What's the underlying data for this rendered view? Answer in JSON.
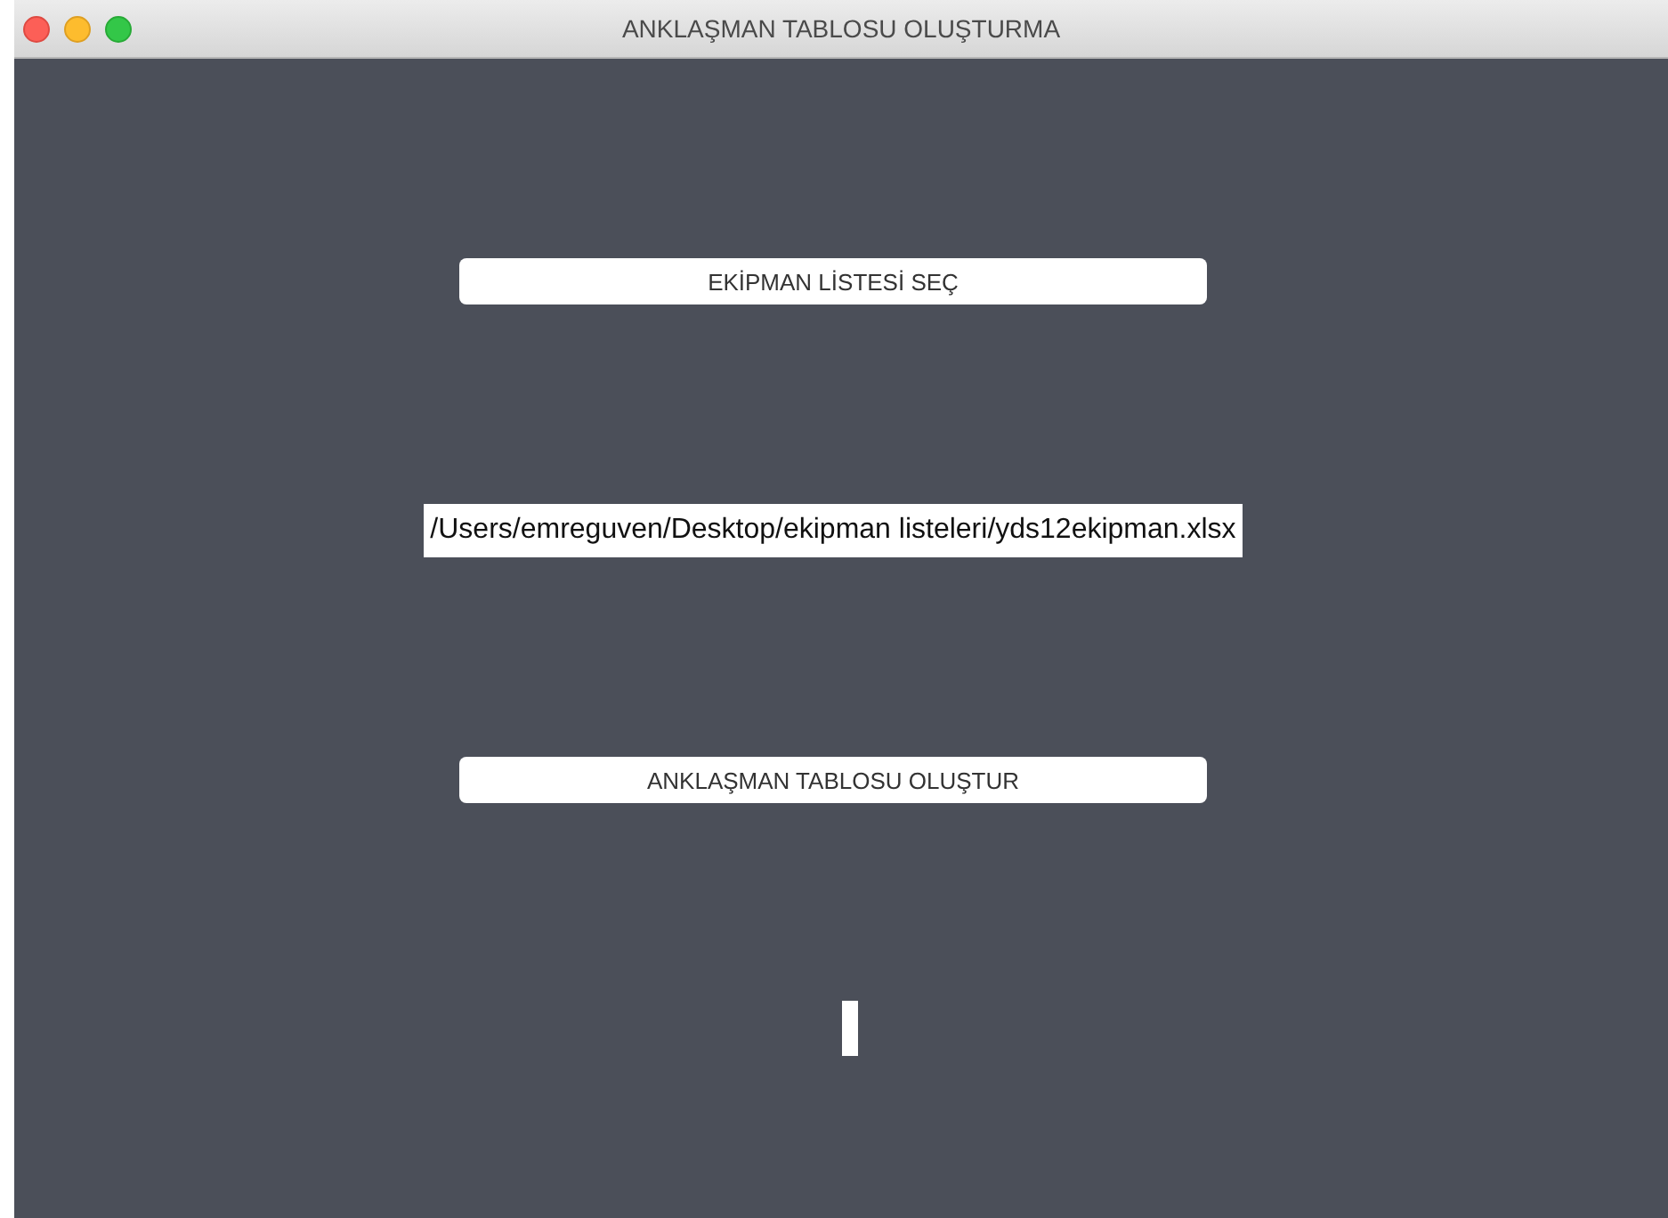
{
  "window": {
    "title": "ANKLAŞMAN TABLOSU OLUŞTURMA"
  },
  "select_button": {
    "label": "EKİPMAN LİSTESİ SEÇ"
  },
  "file_path": {
    "text": "/Users/emreguven/Desktop/ekipman listeleri/yds12ekipman.xlsx"
  },
  "create_button": {
    "label": "ANKLAŞMAN TABLOSU OLUŞTUR"
  }
}
